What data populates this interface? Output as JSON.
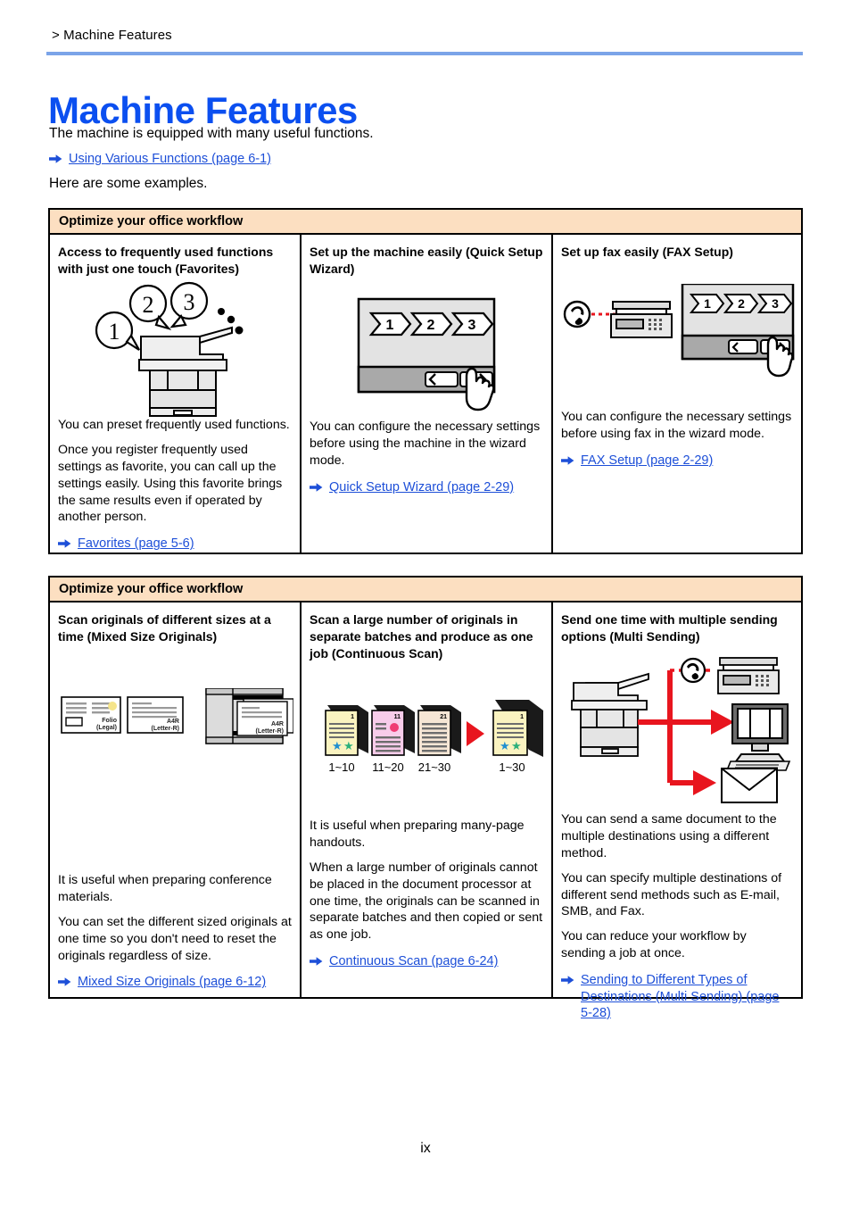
{
  "header": {
    "breadcrumb": "> Machine Features",
    "title": "Machine Features",
    "intro_line_1": "The machine is equipped with many useful functions.",
    "intro_link": "Using Various Functions (page 6-1)",
    "intro_line_2": "Here are some examples."
  },
  "colors": {
    "title_blue": "#0b4ff0",
    "rule_blue": "#7ba4e8",
    "link_blue": "#1d4fd8",
    "table_header_bg": "#fcdfc1",
    "arrow_red": "#e8151e",
    "border_black": "#000000"
  },
  "tables": [
    {
      "header": "Optimize your office workflow",
      "cells": [
        {
          "title": "Access to frequently used functions with just one touch (Favorites)",
          "art": "mfp-with-callouts",
          "paragraphs": [
            "You can preset frequently used functions.",
            "Once you register frequently used settings as favorite, you can call up the settings easily. Using this favorite brings the same results even if operated by another person."
          ],
          "link": "Favorites (page 5-6)",
          "art_labels": [
            "1",
            "2",
            "3"
          ]
        },
        {
          "title": "Set up the machine easily (Quick Setup Wizard)",
          "art": "wizard-screen",
          "paragraphs": [
            "You can configure the necessary settings before using the machine in the wizard mode."
          ],
          "link": "Quick Setup Wizard (page 2-29)",
          "art_labels": [
            "1",
            "2",
            "3"
          ]
        },
        {
          "title": "Set up fax easily (FAX Setup)",
          "art": "fax-wizard-screen",
          "paragraphs": [
            "You can configure the necessary settings before using fax in the wizard mode."
          ],
          "link": "FAX Setup (page 2-29)",
          "art_labels": [
            "1",
            "2",
            "3"
          ]
        }
      ]
    },
    {
      "header": "Optimize your office workflow",
      "cells": [
        {
          "title": "Scan originals of different sizes at a time (Mixed Size Originals)",
          "art": "mixed-size-originals",
          "paragraphs": [
            "It is useful when preparing conference materials.",
            "You can set the different sized originals at one time so you don't need to reset the originals regardless of size."
          ],
          "link": "Mixed Size Originals (page 6-12)",
          "art_labels": [
            "Folio",
            "(Legal)",
            "A4R",
            "(Letter-R)",
            "A4R",
            "(Letter-R)"
          ]
        },
        {
          "title": "Scan a large number of originals in separate batches and produce as one job (Continuous Scan)",
          "art": "continuous-scan",
          "paragraphs": [
            "It is useful when preparing many-page handouts.",
            "When a large number of originals cannot be placed in the document processor at one time, the originals can be scanned in separate batches and then copied or sent as one job."
          ],
          "link": "Continuous Scan (page 6-24)",
          "art_labels": [
            "1~10",
            "11~20",
            "21~30",
            "1~30"
          ],
          "art_badges": [
            "1",
            "11",
            "21",
            "1"
          ]
        },
        {
          "title": "Send one time with multiple sending options (Multi Sending)",
          "art": "multi-sending",
          "paragraphs": [
            "You can send a same document to the multiple destinations using a different method.",
            "You can specify multiple destinations of different send methods such as E-mail, SMB, and Fax.",
            "You can reduce your workflow by sending a job at once."
          ],
          "link": "Sending to Different Types of Destinations (Multi Sending) (page 5-28)",
          "art_labels": []
        }
      ]
    }
  ],
  "footer": {
    "page_number": "ix"
  }
}
